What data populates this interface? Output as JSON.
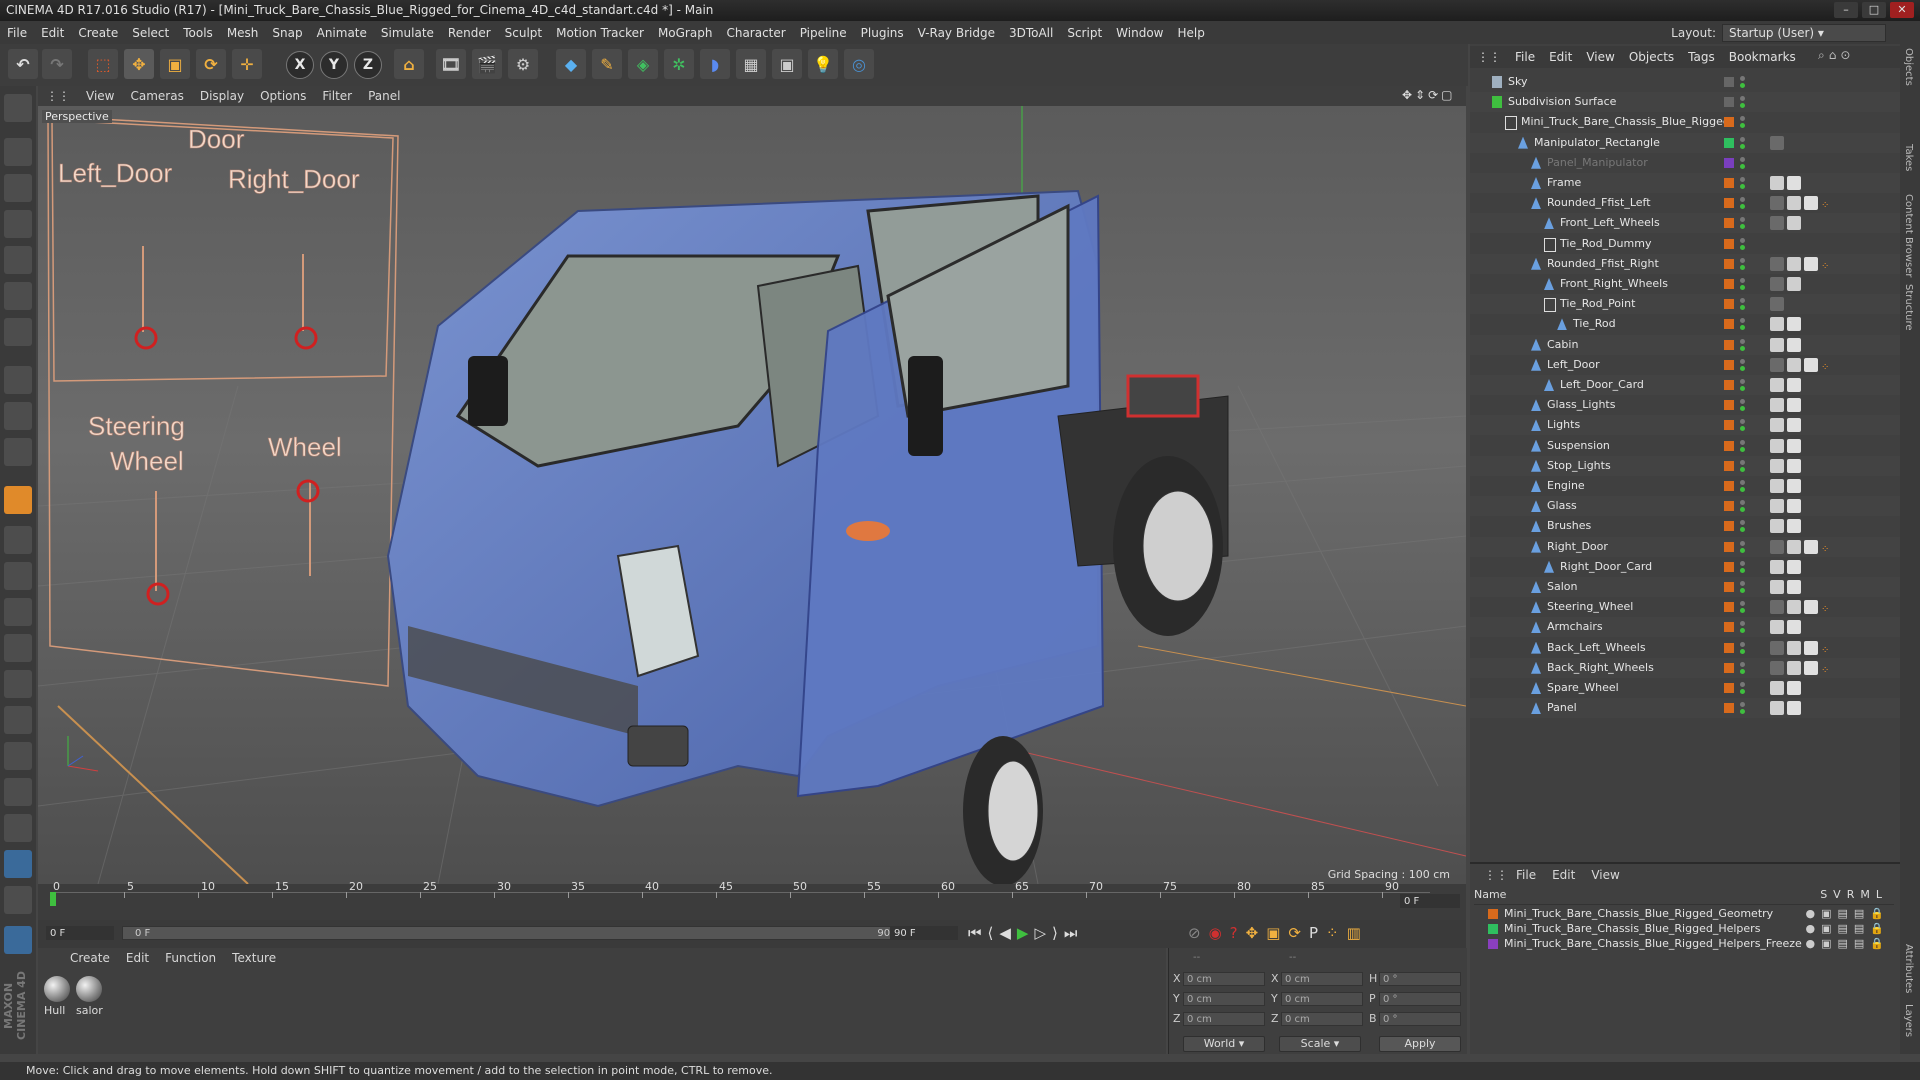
{
  "window": {
    "title": "CINEMA 4D R17.016 Studio (R17) - [Mini_Truck_Bare_Chassis_Blue_Rigged_for_Cinema_4D_c4d_standart.c4d *] - Main"
  },
  "menubar": [
    "File",
    "Edit",
    "Create",
    "Select",
    "Tools",
    "Mesh",
    "Snap",
    "Animate",
    "Simulate",
    "Render",
    "Sculpt",
    "Motion Tracker",
    "MoGraph",
    "Character",
    "Pipeline",
    "Plugins",
    "V-Ray Bridge",
    "3DToAll",
    "Script",
    "Window",
    "Help"
  ],
  "layout": {
    "label": "Layout:",
    "value": "Startup (User)"
  },
  "toolbar": {
    "axis_x": "X",
    "axis_y": "Y",
    "axis_z": "Z"
  },
  "viewport": {
    "menu": [
      "View",
      "Cameras",
      "Display",
      "Options",
      "Filter",
      "Panel"
    ],
    "camera": "Perspective",
    "grid_spacing": "Grid Spacing : 100 cm",
    "labels": {
      "door": "Door",
      "left_door": "Left_Door",
      "right_door": "Right_Door",
      "steering": "Steering",
      "wheel_word": "Wheel",
      "wheel": "Wheel"
    }
  },
  "timeline": {
    "ticks": [
      "0",
      "5",
      "10",
      "15",
      "20",
      "25",
      "30",
      "35",
      "40",
      "45",
      "50",
      "55",
      "60",
      "65",
      "70",
      "75",
      "80",
      "85",
      "90"
    ],
    "end_field": "0 F"
  },
  "transport": {
    "current": "0 F",
    "slider_start": "0 F",
    "slider_end": "90 F",
    "max": "90 F"
  },
  "materials": {
    "menu": [
      "Create",
      "Edit",
      "Function",
      "Texture"
    ],
    "items": [
      "Hull",
      "salor"
    ]
  },
  "coords": {
    "rows": [
      {
        "a": "X",
        "av": "0 cm",
        "b": "X",
        "bv": "0 cm",
        "c": "H",
        "cv": "0 °"
      },
      {
        "a": "Y",
        "av": "0 cm",
        "b": "Y",
        "bv": "0 cm",
        "c": "P",
        "cv": "0 °"
      },
      {
        "a": "Z",
        "av": "0 cm",
        "b": "Z",
        "bv": "0 cm",
        "c": "B",
        "cv": "0 °"
      }
    ],
    "mode1": "World",
    "mode2": "Scale",
    "apply": "Apply",
    "header1": "--",
    "header2": "--"
  },
  "objects": {
    "menu": [
      "File",
      "Edit",
      "View",
      "Objects",
      "Tags",
      "Bookmarks"
    ],
    "items": [
      {
        "name": "Sky",
        "indent": 0
      },
      {
        "name": "Subdivision Surface",
        "indent": 0
      },
      {
        "name": "Mini_Truck_Bare_Chassis_Blue_Rigged",
        "indent": 1
      },
      {
        "name": "Manipulator_Rectangle",
        "indent": 2
      },
      {
        "name": "Panel_Manipulator",
        "indent": 3
      },
      {
        "name": "Frame",
        "indent": 3
      },
      {
        "name": "Rounded_Ffist_Left",
        "indent": 3
      },
      {
        "name": "Front_Left_Wheels",
        "indent": 4
      },
      {
        "name": "Tie_Rod_Dummy",
        "indent": 4
      },
      {
        "name": "Rounded_Ffist_Right",
        "indent": 3
      },
      {
        "name": "Front_Right_Wheels",
        "indent": 4
      },
      {
        "name": "Tie_Rod_Point",
        "indent": 4
      },
      {
        "name": "Tie_Rod",
        "indent": 5
      },
      {
        "name": "Cabin",
        "indent": 3
      },
      {
        "name": "Left_Door",
        "indent": 3
      },
      {
        "name": "Left_Door_Card",
        "indent": 4
      },
      {
        "name": "Glass_Lights",
        "indent": 3
      },
      {
        "name": "Lights",
        "indent": 3
      },
      {
        "name": "Suspension",
        "indent": 3
      },
      {
        "name": "Stop_Lights",
        "indent": 3
      },
      {
        "name": "Engine",
        "indent": 3
      },
      {
        "name": "Glass",
        "indent": 3
      },
      {
        "name": "Brushes",
        "indent": 3
      },
      {
        "name": "Right_Door",
        "indent": 3
      },
      {
        "name": "Right_Door_Card",
        "indent": 4
      },
      {
        "name": "Salon",
        "indent": 3
      },
      {
        "name": "Steering_Wheel",
        "indent": 3
      },
      {
        "name": "Armchairs",
        "indent": 3
      },
      {
        "name": "Back_Left_Wheels",
        "indent": 3
      },
      {
        "name": "Back_Right_Wheels",
        "indent": 3
      },
      {
        "name": "Spare_Wheel",
        "indent": 3
      },
      {
        "name": "Panel",
        "indent": 3
      }
    ]
  },
  "layers": {
    "menu": [
      "File",
      "Edit",
      "View"
    ],
    "header": {
      "name": "Name",
      "cols": [
        "S",
        "V",
        "R",
        "M",
        "L"
      ]
    },
    "items": [
      {
        "name": "Mini_Truck_Bare_Chassis_Blue_Rigged_Geometry",
        "color": "#d86a1c"
      },
      {
        "name": "Mini_Truck_Bare_Chassis_Blue_Rigged_Helpers",
        "color": "#2fbf5f"
      },
      {
        "name": "Mini_Truck_Bare_Chassis_Blue_Rigged_Helpers_Freeze",
        "color": "#8a3fbf"
      }
    ]
  },
  "side_tabs": [
    "Objects",
    "Takes",
    "Content Browser",
    "Structure",
    "Attributes",
    "Layers"
  ],
  "branding": "MAXON CINEMA 4D",
  "status": "Move: Click and drag to move elements. Hold down SHIFT to quantize movement / add to the selection in point mode, CTRL to remove."
}
